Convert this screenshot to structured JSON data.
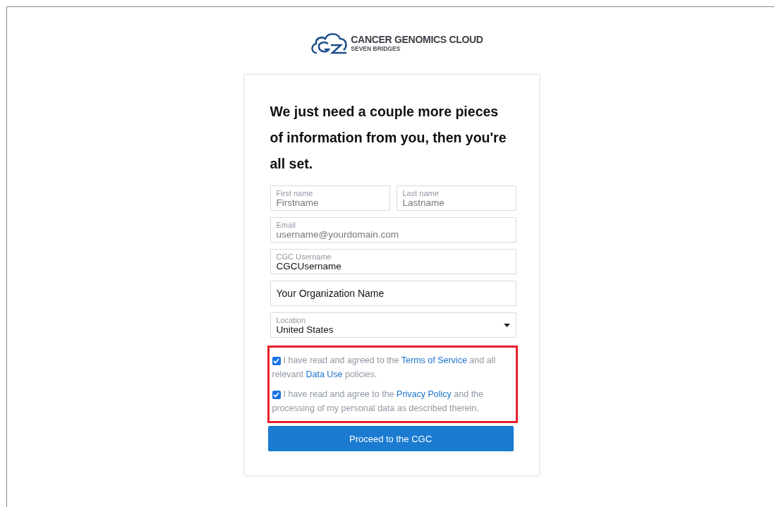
{
  "logo": {
    "title": "CANCER GENOMICS CLOUD",
    "subtitle": "SEVEN BRIDGES"
  },
  "heading": "We just need a couple more pieces of information from you, then you're all set.",
  "name_fields": [
    {
      "label": "First name",
      "placeholder": "Firstname"
    },
    {
      "label": "Last name",
      "placeholder": "Lastname"
    }
  ],
  "fields": [
    {
      "label": "Email",
      "placeholder": "username@yourdomain.com"
    },
    {
      "label": "CGC Username",
      "value": "CGCUsername"
    },
    {
      "value": "Your Organization Name"
    }
  ],
  "location": {
    "label": "Location",
    "value": "United States"
  },
  "agreements": [
    {
      "checked": true,
      "parts": [
        {
          "kind": "text",
          "text": "I have read and agreed to the "
        },
        {
          "kind": "link",
          "text": "Terms of Service"
        },
        {
          "kind": "text",
          "text": " and all relevant "
        },
        {
          "kind": "link",
          "text": "Data Use"
        },
        {
          "kind": "text",
          "text": " policies."
        }
      ]
    },
    {
      "checked": true,
      "parts": [
        {
          "kind": "text",
          "text": "I have read and agree to the "
        },
        {
          "kind": "link",
          "text": "Privacy Policy"
        },
        {
          "kind": "text",
          "text": " and the processing of my personal data as described therein."
        }
      ]
    }
  ],
  "button": "Proceed to the CGC"
}
